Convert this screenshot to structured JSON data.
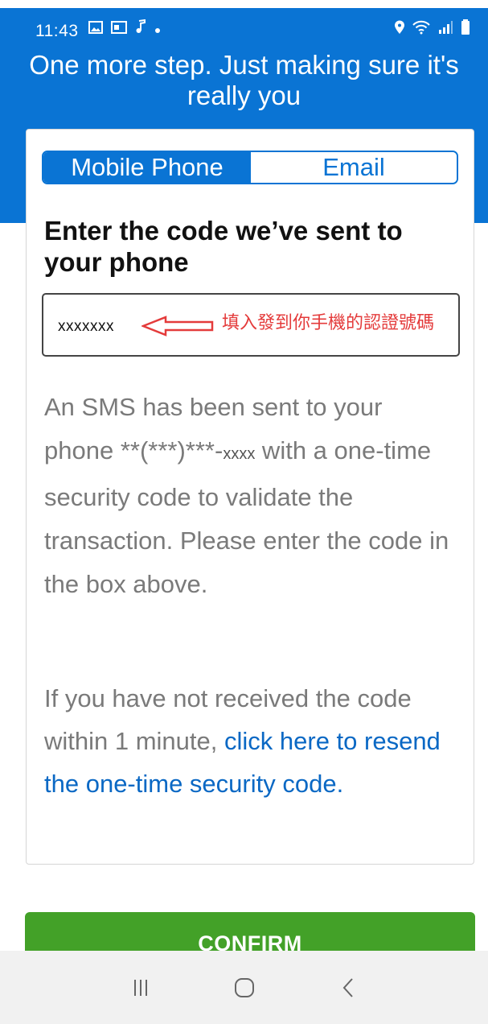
{
  "status_bar": {
    "time": "11:43",
    "left_icons": [
      "gallery-icon",
      "notification-icon",
      "music-icon",
      "dot-icon"
    ],
    "right_icons": [
      "location-icon",
      "wifi-icon",
      "signal-icon",
      "battery-icon"
    ]
  },
  "header": {
    "title": "One more step. Just making sure it's really you"
  },
  "tabs": [
    {
      "label": "Mobile Phone",
      "active": true
    },
    {
      "label": "Email",
      "active": false
    }
  ],
  "form": {
    "heading": "Enter the code we’ve sent to your phone",
    "code_value": "xxxxxxx",
    "annotation": "填入發到你手機的認證號碼"
  },
  "description": {
    "text_before": "An SMS has been sent to your phone **(***)***-",
    "masked_digits": "xxxx",
    "text_after": " with a one-time security code to validate the transaction. Please enter the code in the box above."
  },
  "resend": {
    "prefix": "If you have not received the code within 1 minute, ",
    "link": "click here to resend the one-time security code."
  },
  "confirm_label": "CONFIRM",
  "nav": [
    "recent-apps-icon",
    "home-icon",
    "back-icon"
  ],
  "colors": {
    "header_blue": "#0a74d4",
    "confirm_green": "#43a128",
    "annotation_red": "#e43b3b"
  }
}
